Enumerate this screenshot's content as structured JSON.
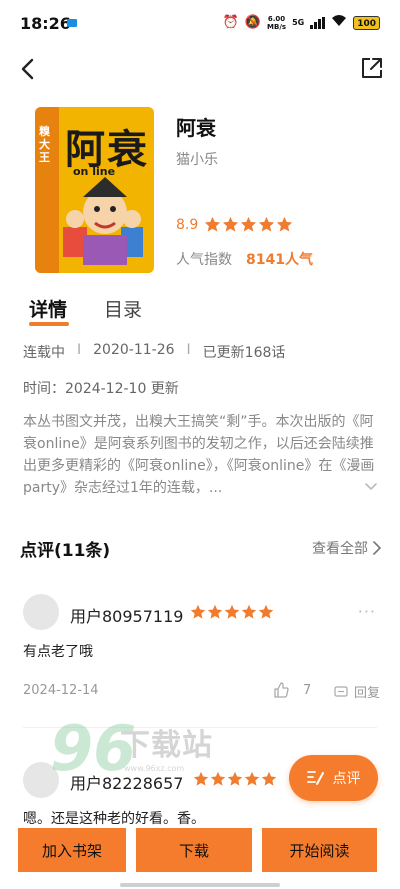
{
  "status_bar": {
    "time": "18:26",
    "speed_value": "6.00",
    "speed_unit": "MB/s",
    "network": "5G",
    "battery": "100"
  },
  "book": {
    "title": "阿衰",
    "author": "猫小乐",
    "rating": "8.9",
    "rating_stars": 5,
    "popularity_label": "人气指数",
    "popularity_value": "8141人气",
    "cover": {
      "title": "阿衰",
      "subtitle": "on line",
      "side_text": "糗大王"
    }
  },
  "tabs": [
    {
      "label": "详情",
      "active": true
    },
    {
      "label": "目录",
      "active": false
    }
  ],
  "meta": {
    "status": "连载中",
    "date": "2020-11-26",
    "chapters": "已更新168话",
    "separator": "I",
    "time_line": "时间：2024-12-10 更新"
  },
  "description": "本丛书图文并茂，出糗大王搞笑“剩”手。本次出版的《阿衰online》是阿衰系列图书的发轫之作，以后还会陆续推出更多更精彩的《阿衰online》，《阿衰online》在《漫画party》杂志经过1年的连载，...",
  "reviews": {
    "title": "点评(11条)",
    "view_all": "查看全部",
    "items": [
      {
        "user": "用户80957119",
        "stars": 5,
        "text": "有点老了哦",
        "date": "2024-12-14",
        "likes": "7",
        "reply_label": "回复"
      },
      {
        "user": "用户82228657",
        "stars": 5,
        "text": "嗯。还是这种老的好看。香。"
      }
    ]
  },
  "watermark": {
    "digits": "96",
    "text": "下载站",
    "url": "www.96xz.com"
  },
  "fab": {
    "label": "点评"
  },
  "bottom_bar": {
    "add_shelf": "加入书架",
    "download": "下载",
    "start_reading": "开始阅读"
  },
  "colors": {
    "accent": "#f57c2c",
    "star": "#f07d2f"
  },
  "icons": [
    "back-icon",
    "share-icon",
    "star-icon",
    "chevron-right-icon",
    "chevron-down-icon",
    "more-icon",
    "thumb-up-icon",
    "comment-icon",
    "write-icon"
  ]
}
